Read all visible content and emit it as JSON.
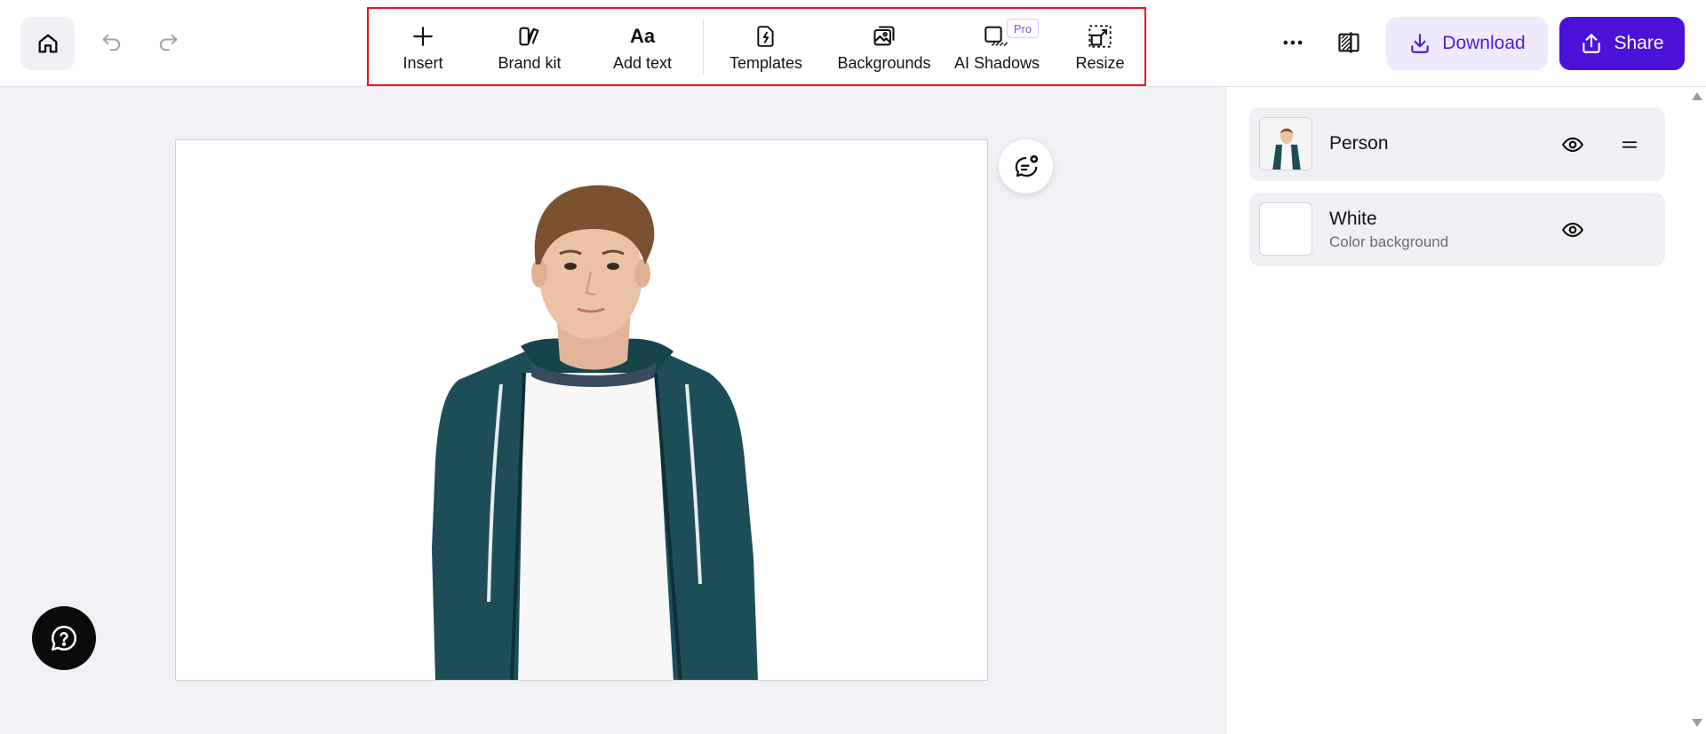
{
  "toolbar": {
    "tools": [
      {
        "label": "Insert",
        "icon": "plus-icon"
      },
      {
        "label": "Brand kit",
        "icon": "brand-kit-icon"
      },
      {
        "label": "Add text",
        "icon": "text-icon",
        "glyph": "Aa"
      },
      {
        "label": "Templates",
        "icon": "templates-icon"
      },
      {
        "label": "Backgrounds",
        "icon": "backgrounds-icon"
      },
      {
        "label": "AI Shadows",
        "icon": "ai-shadows-icon",
        "badge": "Pro"
      },
      {
        "label": "Resize",
        "icon": "resize-icon"
      }
    ],
    "highlight_color": "#e8141c"
  },
  "header": {
    "download_label": "Download",
    "share_label": "Share",
    "accent_color": "#4a12d8",
    "download_bg": "#efeaff"
  },
  "layers": [
    {
      "name": "Person",
      "subtitle": "",
      "thumb": "person-photo"
    },
    {
      "name": "White",
      "subtitle": "Color background",
      "thumb": "white-swatch"
    }
  ],
  "canvas": {
    "background_color": "#ffffff",
    "subject": "person-cutout"
  },
  "colors": {
    "app_bg": "#f0f1f5",
    "hoodie": "#1d4e57",
    "shirt": "#f7f7f7"
  }
}
